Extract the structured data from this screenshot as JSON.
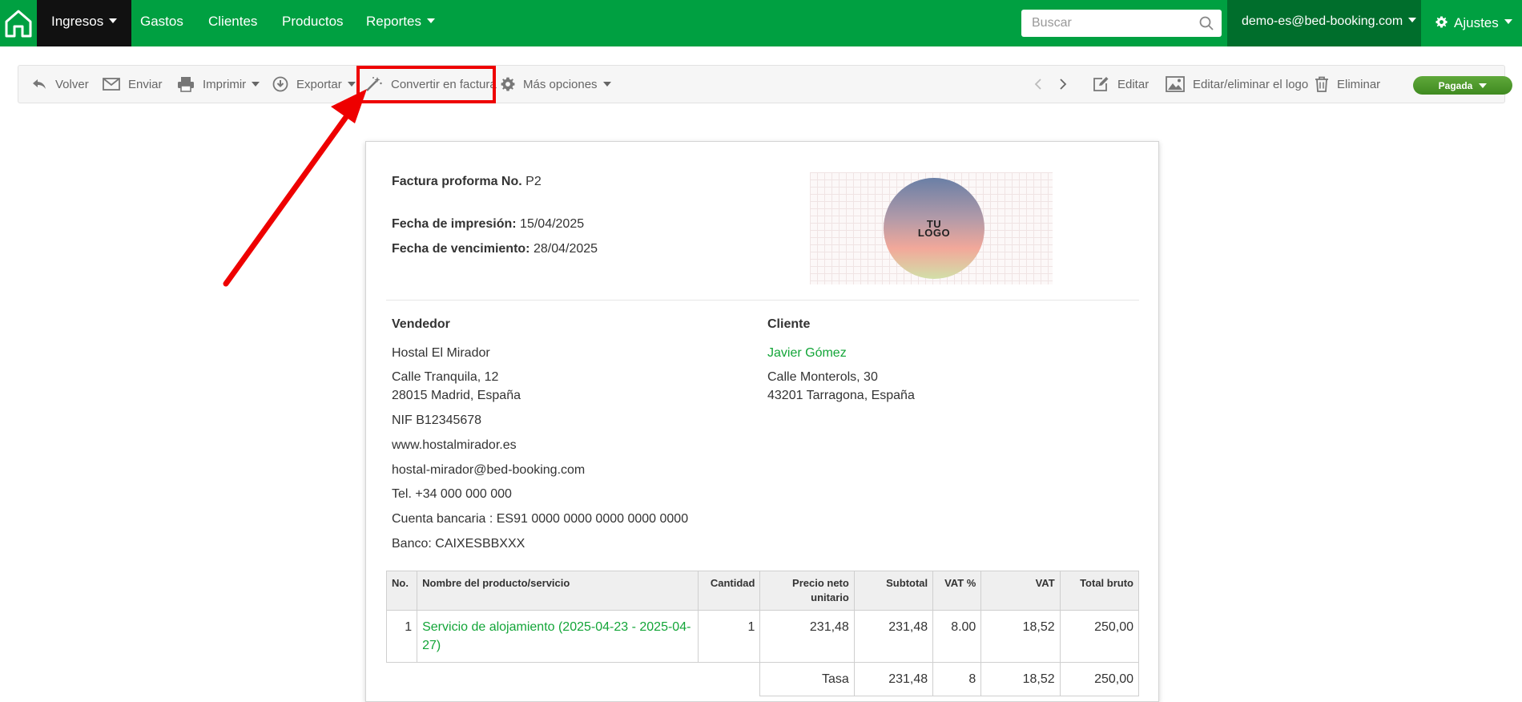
{
  "nav": {
    "items": [
      {
        "label": "Ingresos",
        "dropdown": true,
        "active": true
      },
      {
        "label": "Gastos"
      },
      {
        "label": "Clientes"
      },
      {
        "label": "Productos"
      },
      {
        "label": "Reportes",
        "dropdown": true
      }
    ],
    "search_placeholder": "Buscar",
    "account": "demo-es@bed-booking.com",
    "settings": "Ajustes"
  },
  "toolbar": {
    "back": "Volver",
    "send": "Enviar",
    "print": "Imprimir",
    "export": "Exportar",
    "convert": "Convertir en factura",
    "more": "Más opciones",
    "edit": "Editar",
    "edit_logo": "Editar/eliminar el logo",
    "delete": "Eliminar",
    "status": "Pagada"
  },
  "colors": {
    "brand": "#00a041",
    "highlight": "#ee0000",
    "link": "#13a538"
  },
  "doc": {
    "title_label": "Factura proforma No.",
    "number": "P2",
    "print_date_label": "Fecha de impresión:",
    "print_date": "15/04/2025",
    "due_date_label": "Fecha de vencimiento:",
    "due_date": "28/04/2025",
    "logo_line1": "TU",
    "logo_line2": "LOGO",
    "seller": {
      "heading": "Vendedor",
      "name": "Hostal El Mirador",
      "address1": "Calle Tranquila, 12",
      "address2": "28015 Madrid, España",
      "nif": "NIF B12345678",
      "web": "www.hostalmirador.es",
      "email": "hostal-mirador@bed-booking.com",
      "tel": "Tel. +34 000 000 000",
      "bank_account": "Cuenta bancaria : ES91 0000 0000 0000 0000 0000",
      "bank": "Banco: CAIXESBBXXX"
    },
    "client": {
      "heading": "Cliente",
      "name": "Javier Gómez",
      "address1": "Calle Monterols, 30",
      "address2": "43201 Tarragona, España"
    },
    "table": {
      "headers": [
        "No.",
        "Nombre del producto/servicio",
        "Cantidad",
        "Precio neto unitario",
        "Subtotal",
        "VAT %",
        "VAT",
        "Total bruto"
      ],
      "rows": [
        [
          "1",
          "Servicio de alojamiento (2025-04-23 - 2025-04-27)",
          "1",
          "231,48",
          "231,48",
          "8.00",
          "18,52",
          "250,00"
        ]
      ],
      "totals": [
        "Tasa",
        "231,48",
        "8",
        "18,52",
        "250,00"
      ]
    }
  }
}
